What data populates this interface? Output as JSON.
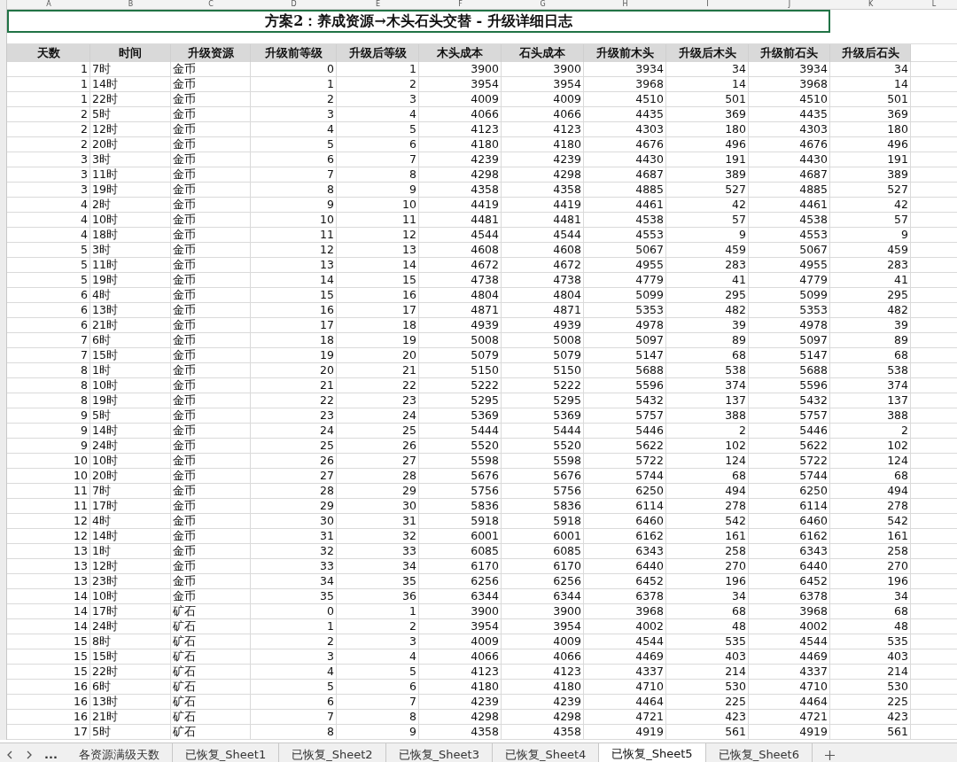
{
  "column_letters": [
    "A",
    "B",
    "C",
    "D",
    "E",
    "F",
    "G",
    "H",
    "I",
    "J",
    "K",
    "L"
  ],
  "title": "方案2：养成资源→木头石头交替 - 升级详细日志",
  "table": {
    "columns": [
      "天数",
      "时间",
      "升级资源",
      "升级前等级",
      "升级后等级",
      "木头成本",
      "石头成本",
      "升级前木头",
      "升级后木头",
      "升级前石头",
      "升级后石头"
    ],
    "rows": [
      [
        "1",
        "7时",
        "金币",
        "0",
        "1",
        "3900",
        "3900",
        "3934",
        "34",
        "3934",
        "34"
      ],
      [
        "1",
        "14时",
        "金币",
        "1",
        "2",
        "3954",
        "3954",
        "3968",
        "14",
        "3968",
        "14"
      ],
      [
        "1",
        "22时",
        "金币",
        "2",
        "3",
        "4009",
        "4009",
        "4510",
        "501",
        "4510",
        "501"
      ],
      [
        "2",
        "5时",
        "金币",
        "3",
        "4",
        "4066",
        "4066",
        "4435",
        "369",
        "4435",
        "369"
      ],
      [
        "2",
        "12时",
        "金币",
        "4",
        "5",
        "4123",
        "4123",
        "4303",
        "180",
        "4303",
        "180"
      ],
      [
        "2",
        "20时",
        "金币",
        "5",
        "6",
        "4180",
        "4180",
        "4676",
        "496",
        "4676",
        "496"
      ],
      [
        "3",
        "3时",
        "金币",
        "6",
        "7",
        "4239",
        "4239",
        "4430",
        "191",
        "4430",
        "191"
      ],
      [
        "3",
        "11时",
        "金币",
        "7",
        "8",
        "4298",
        "4298",
        "4687",
        "389",
        "4687",
        "389"
      ],
      [
        "3",
        "19时",
        "金币",
        "8",
        "9",
        "4358",
        "4358",
        "4885",
        "527",
        "4885",
        "527"
      ],
      [
        "4",
        "2时",
        "金币",
        "9",
        "10",
        "4419",
        "4419",
        "4461",
        "42",
        "4461",
        "42"
      ],
      [
        "4",
        "10时",
        "金币",
        "10",
        "11",
        "4481",
        "4481",
        "4538",
        "57",
        "4538",
        "57"
      ],
      [
        "4",
        "18时",
        "金币",
        "11",
        "12",
        "4544",
        "4544",
        "4553",
        "9",
        "4553",
        "9"
      ],
      [
        "5",
        "3时",
        "金币",
        "12",
        "13",
        "4608",
        "4608",
        "5067",
        "459",
        "5067",
        "459"
      ],
      [
        "5",
        "11时",
        "金币",
        "13",
        "14",
        "4672",
        "4672",
        "4955",
        "283",
        "4955",
        "283"
      ],
      [
        "5",
        "19时",
        "金币",
        "14",
        "15",
        "4738",
        "4738",
        "4779",
        "41",
        "4779",
        "41"
      ],
      [
        "6",
        "4时",
        "金币",
        "15",
        "16",
        "4804",
        "4804",
        "5099",
        "295",
        "5099",
        "295"
      ],
      [
        "6",
        "13时",
        "金币",
        "16",
        "17",
        "4871",
        "4871",
        "5353",
        "482",
        "5353",
        "482"
      ],
      [
        "6",
        "21时",
        "金币",
        "17",
        "18",
        "4939",
        "4939",
        "4978",
        "39",
        "4978",
        "39"
      ],
      [
        "7",
        "6时",
        "金币",
        "18",
        "19",
        "5008",
        "5008",
        "5097",
        "89",
        "5097",
        "89"
      ],
      [
        "7",
        "15时",
        "金币",
        "19",
        "20",
        "5079",
        "5079",
        "5147",
        "68",
        "5147",
        "68"
      ],
      [
        "8",
        "1时",
        "金币",
        "20",
        "21",
        "5150",
        "5150",
        "5688",
        "538",
        "5688",
        "538"
      ],
      [
        "8",
        "10时",
        "金币",
        "21",
        "22",
        "5222",
        "5222",
        "5596",
        "374",
        "5596",
        "374"
      ],
      [
        "8",
        "19时",
        "金币",
        "22",
        "23",
        "5295",
        "5295",
        "5432",
        "137",
        "5432",
        "137"
      ],
      [
        "9",
        "5时",
        "金币",
        "23",
        "24",
        "5369",
        "5369",
        "5757",
        "388",
        "5757",
        "388"
      ],
      [
        "9",
        "14时",
        "金币",
        "24",
        "25",
        "5444",
        "5444",
        "5446",
        "2",
        "5446",
        "2"
      ],
      [
        "9",
        "24时",
        "金币",
        "25",
        "26",
        "5520",
        "5520",
        "5622",
        "102",
        "5622",
        "102"
      ],
      [
        "10",
        "10时",
        "金币",
        "26",
        "27",
        "5598",
        "5598",
        "5722",
        "124",
        "5722",
        "124"
      ],
      [
        "10",
        "20时",
        "金币",
        "27",
        "28",
        "5676",
        "5676",
        "5744",
        "68",
        "5744",
        "68"
      ],
      [
        "11",
        "7时",
        "金币",
        "28",
        "29",
        "5756",
        "5756",
        "6250",
        "494",
        "6250",
        "494"
      ],
      [
        "11",
        "17时",
        "金币",
        "29",
        "30",
        "5836",
        "5836",
        "6114",
        "278",
        "6114",
        "278"
      ],
      [
        "12",
        "4时",
        "金币",
        "30",
        "31",
        "5918",
        "5918",
        "6460",
        "542",
        "6460",
        "542"
      ],
      [
        "12",
        "14时",
        "金币",
        "31",
        "32",
        "6001",
        "6001",
        "6162",
        "161",
        "6162",
        "161"
      ],
      [
        "13",
        "1时",
        "金币",
        "32",
        "33",
        "6085",
        "6085",
        "6343",
        "258",
        "6343",
        "258"
      ],
      [
        "13",
        "12时",
        "金币",
        "33",
        "34",
        "6170",
        "6170",
        "6440",
        "270",
        "6440",
        "270"
      ],
      [
        "13",
        "23时",
        "金币",
        "34",
        "35",
        "6256",
        "6256",
        "6452",
        "196",
        "6452",
        "196"
      ],
      [
        "14",
        "10时",
        "金币",
        "35",
        "36",
        "6344",
        "6344",
        "6378",
        "34",
        "6378",
        "34"
      ],
      [
        "14",
        "17时",
        "矿石",
        "0",
        "1",
        "3900",
        "3900",
        "3968",
        "68",
        "3968",
        "68"
      ],
      [
        "14",
        "24时",
        "矿石",
        "1",
        "2",
        "3954",
        "3954",
        "4002",
        "48",
        "4002",
        "48"
      ],
      [
        "15",
        "8时",
        "矿石",
        "2",
        "3",
        "4009",
        "4009",
        "4544",
        "535",
        "4544",
        "535"
      ],
      [
        "15",
        "15时",
        "矿石",
        "3",
        "4",
        "4066",
        "4066",
        "4469",
        "403",
        "4469",
        "403"
      ],
      [
        "15",
        "22时",
        "矿石",
        "4",
        "5",
        "4123",
        "4123",
        "4337",
        "214",
        "4337",
        "214"
      ],
      [
        "16",
        "6时",
        "矿石",
        "5",
        "6",
        "4180",
        "4180",
        "4710",
        "530",
        "4710",
        "530"
      ],
      [
        "16",
        "13时",
        "矿石",
        "6",
        "7",
        "4239",
        "4239",
        "4464",
        "225",
        "4464",
        "225"
      ],
      [
        "16",
        "21时",
        "矿石",
        "7",
        "8",
        "4298",
        "4298",
        "4721",
        "423",
        "4721",
        "423"
      ],
      [
        "17",
        "5时",
        "矿石",
        "8",
        "9",
        "4358",
        "4358",
        "4919",
        "561",
        "4919",
        "561"
      ]
    ]
  },
  "tab_bar": {
    "more": "...",
    "tabs": [
      {
        "label": "各资源满级天数",
        "selected": false
      },
      {
        "label": "已恢复_Sheet1",
        "selected": false
      },
      {
        "label": "已恢复_Sheet2",
        "selected": false
      },
      {
        "label": "已恢复_Sheet3",
        "selected": false
      },
      {
        "label": "已恢复_Sheet4",
        "selected": false
      },
      {
        "label": "已恢复_Sheet5",
        "selected": true
      },
      {
        "label": "已恢复_Sheet6",
        "selected": false
      }
    ]
  }
}
